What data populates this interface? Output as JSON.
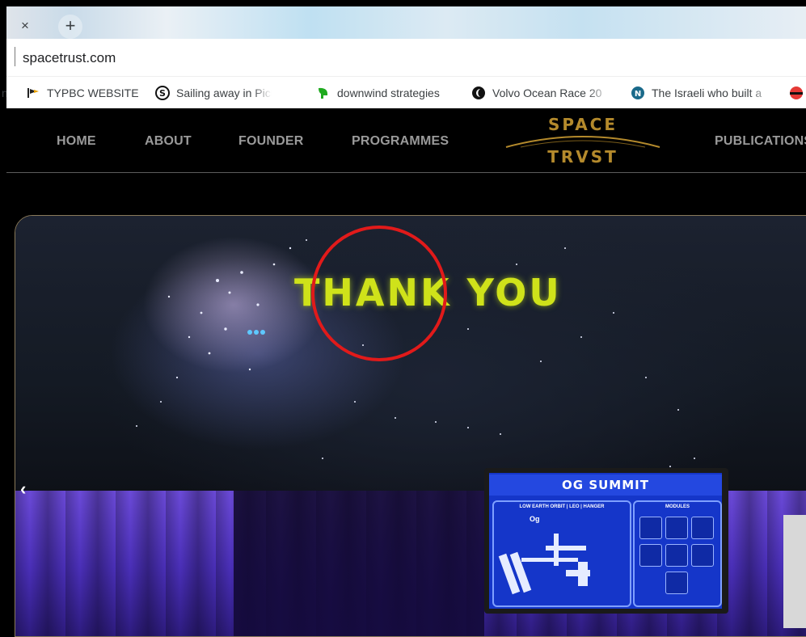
{
  "browser": {
    "tab_close_glyph": "×",
    "new_tab_glyph": "+",
    "address": "spacetrust.com",
    "bookmarks": [
      {
        "label": "TYPBC WEBSITE",
        "icon": "flag-icon"
      },
      {
        "label": "Sailing away in Pictor",
        "icon": "s-circle-icon"
      },
      {
        "label": "downwind strategies",
        "icon": "leaf-icon"
      },
      {
        "label": "Volvo Ocean Race 20",
        "icon": "moon-icon"
      },
      {
        "label": "The Israeli who built a",
        "icon": "n-circle-icon"
      }
    ]
  },
  "site": {
    "nav": [
      "HOME",
      "ABOUT",
      "FOUNDER",
      "PROGRAMMES",
      "PUBLICATIONS"
    ],
    "logo_top": "SPACE",
    "logo_bottom": "TRVST",
    "accent_color": "#b48a2c"
  },
  "hero": {
    "screen_text": "THANK YOU",
    "prev_glyph": "‹",
    "highlight_color": "#e11a1a",
    "monitor": {
      "title": "OG SUMMIT",
      "left_label": "LOW EARTH ORBIT | LEO | HANGER",
      "right_label": "MODULES",
      "left_badge": "Og"
    }
  }
}
